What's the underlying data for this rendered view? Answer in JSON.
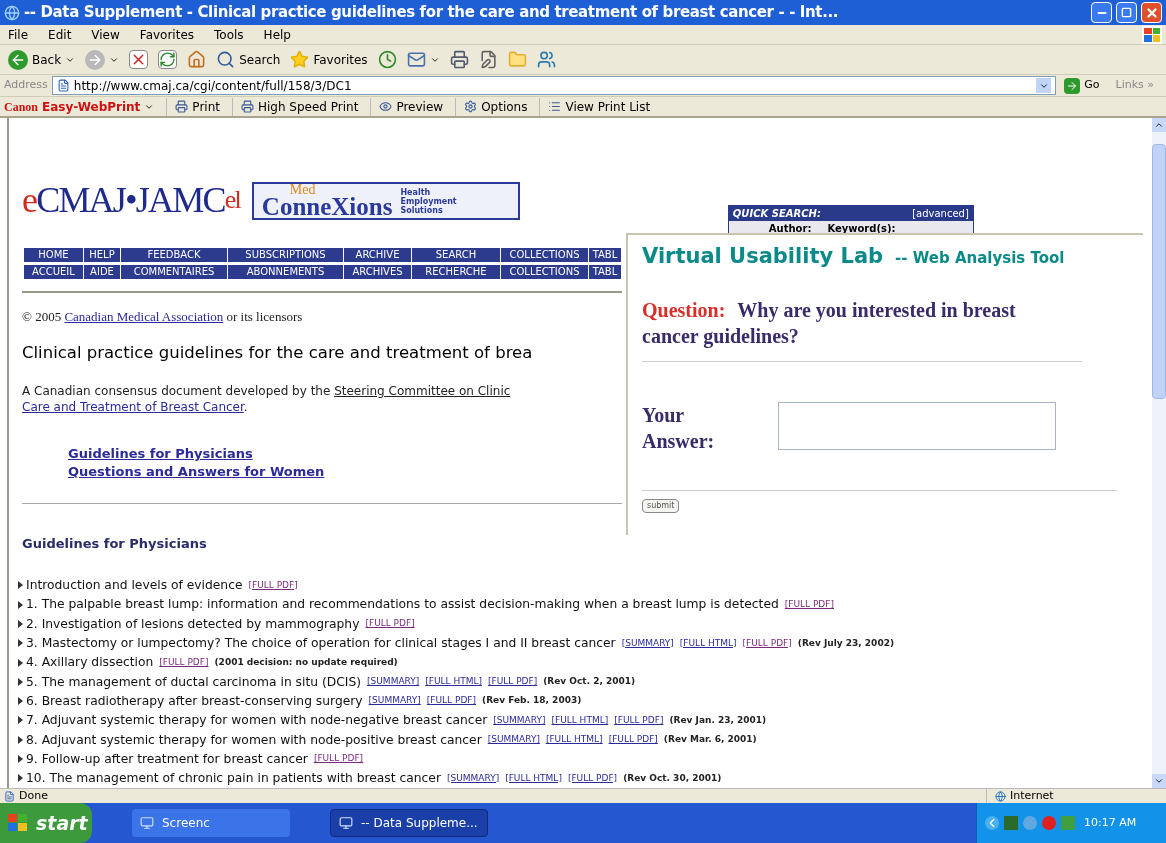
{
  "window": {
    "title": "-- Data Supplement - Clinical practice guidelines for the care and treatment of breast cancer - - Int..."
  },
  "menu": [
    "File",
    "Edit",
    "View",
    "Favorites",
    "Tools",
    "Help"
  ],
  "toolbar": [
    {
      "kind": "back",
      "label": "Back"
    },
    {
      "kind": "forward"
    },
    {
      "kind": "stop"
    },
    {
      "kind": "refresh"
    },
    {
      "kind": "home"
    },
    {
      "kind": "search",
      "label": "Search"
    },
    {
      "kind": "favorites",
      "label": "Favorites"
    },
    {
      "kind": "history"
    },
    {
      "kind": "mail"
    },
    {
      "kind": "print"
    },
    {
      "kind": "edit"
    },
    {
      "kind": "folder"
    },
    {
      "kind": "messenger"
    }
  ],
  "address": {
    "label": "Address",
    "value": "http://www.cmaj.ca/cgi/content/full/158/3/DC1",
    "go": "Go",
    "links": "Links »"
  },
  "print_bar": {
    "brand": "Canon",
    "product": "Easy-WebPrint",
    "buttons": [
      {
        "kind": "print",
        "label": "Print"
      },
      {
        "kind": "print",
        "label": "High Speed Print"
      },
      {
        "kind": "preview",
        "label": "Preview"
      },
      {
        "kind": "options",
        "label": "Options"
      },
      {
        "kind": "list",
        "label": "View Print List"
      }
    ]
  },
  "page": {
    "logo": [
      {
        "text": "e",
        "color": "#d42a1e"
      },
      {
        "text": "CMAJ•JAMC",
        "color": "#1e2a8c"
      },
      {
        "text": "el",
        "color": "#d42a1e"
      }
    ],
    "partner": {
      "top": "Med",
      "main": "ConneXions",
      "tagline": [
        "Health",
        "Employment",
        "Solutions"
      ]
    },
    "quick_search": {
      "title": "QUICK SEARCH:",
      "advanced": "[advanced]",
      "fields": [
        "Author:",
        "Keyword(s):"
      ]
    },
    "nav_rows": [
      [
        "HOME",
        "HELP",
        "FEEDBACK",
        "SUBSCRIPTIONS",
        "ARCHIVE",
        "SEARCH",
        "COLLECTIONS",
        "TABL"
      ],
      [
        "ACCUEIL",
        "AIDE",
        "COMMENTAIRES",
        "ABONNEMENTS",
        "ARCHIVES",
        "RECHERCHE",
        "COLLECTIONS",
        "TABL"
      ]
    ],
    "copyright": {
      "before": "© 2005",
      "link": "Canadian Medical Association",
      "after": "or its licensors"
    },
    "heading": "Clinical practice guidelines for the care and treatment of brea",
    "intro": {
      "before": "A Canadian consensus document developed by the",
      "link_lines": [
        "Steering Committee on Clinic",
        "Care and Treatment of Breast Cancer"
      ],
      "after": "."
    },
    "toc": [
      "Guidelines for Physicians",
      "Questions and Answers for Women"
    ],
    "section_title": "Guidelines for Physicians",
    "items": [
      {
        "text": "Introduction and levels of evidence",
        "links": [
          {
            "label": "[FULL PDF]",
            "visited": true
          }
        ]
      },
      {
        "text": "1. The palpable breast lump: information and recommendations to assist decision-making when a breast lump is detected",
        "links": [
          {
            "label": "[FULL PDF]",
            "visited": true
          }
        ]
      },
      {
        "text": "2. Investigation of lesions detected by mammography",
        "links": [
          {
            "label": "[FULL PDF]",
            "visited": true
          }
        ]
      },
      {
        "text": "3. Mastectomy or lumpectomy? The choice of operation for clinical stages I and II breast cancer",
        "links": [
          {
            "label": "[SUMMARY]",
            "visited": false
          },
          {
            "label": "[FULL HTML]",
            "visited": false
          },
          {
            "label": "[FULL PDF]",
            "visited": true
          }
        ],
        "note": "(Rev July 23, 2002)"
      },
      {
        "text": "4. Axillary dissection",
        "links": [
          {
            "label": "[FULL PDF]",
            "visited": true
          }
        ],
        "note": "(2001 decision: no update required)"
      },
      {
        "text": "5. The management of ductal carcinoma in situ (DCIS)",
        "links": [
          {
            "label": "[SUMMARY]",
            "visited": false
          },
          {
            "label": "[FULL HTML]",
            "visited": false
          },
          {
            "label": "[FULL PDF]",
            "visited": false
          }
        ],
        "note": "(Rev Oct. 2, 2001)"
      },
      {
        "text": "6. Breast radiotherapy after breast-conserving surgery",
        "links": [
          {
            "label": "[SUMMARY]",
            "visited": false
          },
          {
            "label": "[FULL PDF]",
            "visited": false
          }
        ],
        "note": "(Rev Feb. 18, 2003)"
      },
      {
        "text": "7. Adjuvant systemic therapy for women with node-negative breast cancer",
        "links": [
          {
            "label": "[SUMMARY]",
            "visited": false
          },
          {
            "label": "[FULL HTML]",
            "visited": false
          },
          {
            "label": "[FULL PDF]",
            "visited": false
          }
        ],
        "note": "(Rev Jan. 23, 2001)"
      },
      {
        "text": "8. Adjuvant systemic therapy for women with node-positive breast cancer",
        "links": [
          {
            "label": "[SUMMARY]",
            "visited": false
          },
          {
            "label": "[FULL HTML]",
            "visited": false
          },
          {
            "label": "[FULL PDF]",
            "visited": false
          }
        ],
        "note": "(Rev Mar. 6, 2001)"
      },
      {
        "text": "9. Follow-up after treatment for breast cancer",
        "links": [
          {
            "label": "[FULL PDF]",
            "visited": true
          }
        ]
      },
      {
        "text": "10. The management of chronic pain in patients with breast cancer",
        "links": [
          {
            "label": "[SUMMARY]",
            "visited": false
          },
          {
            "label": "[FULL HTML]",
            "visited": false
          },
          {
            "label": "[FULL PDF]",
            "visited": false
          }
        ],
        "note": "(Rev Oct. 30, 2001)"
      }
    ]
  },
  "popup": {
    "title": "Virtual Usability Lab",
    "subtitle": "-- Web Analysis Tool",
    "question_label": "Question:",
    "question": "Why are you interested in breast cancer guidelines?",
    "answer_label": "Your Answer:",
    "submit": "submit"
  },
  "status_bar": {
    "status": "Done",
    "zone": "Internet"
  },
  "taskbar": {
    "start": "start",
    "tasks": [
      {
        "label": "Screenc",
        "selected": false
      },
      {
        "label": "-- Data Suppleme...",
        "selected": true
      }
    ],
    "clock": "10:17 AM"
  }
}
